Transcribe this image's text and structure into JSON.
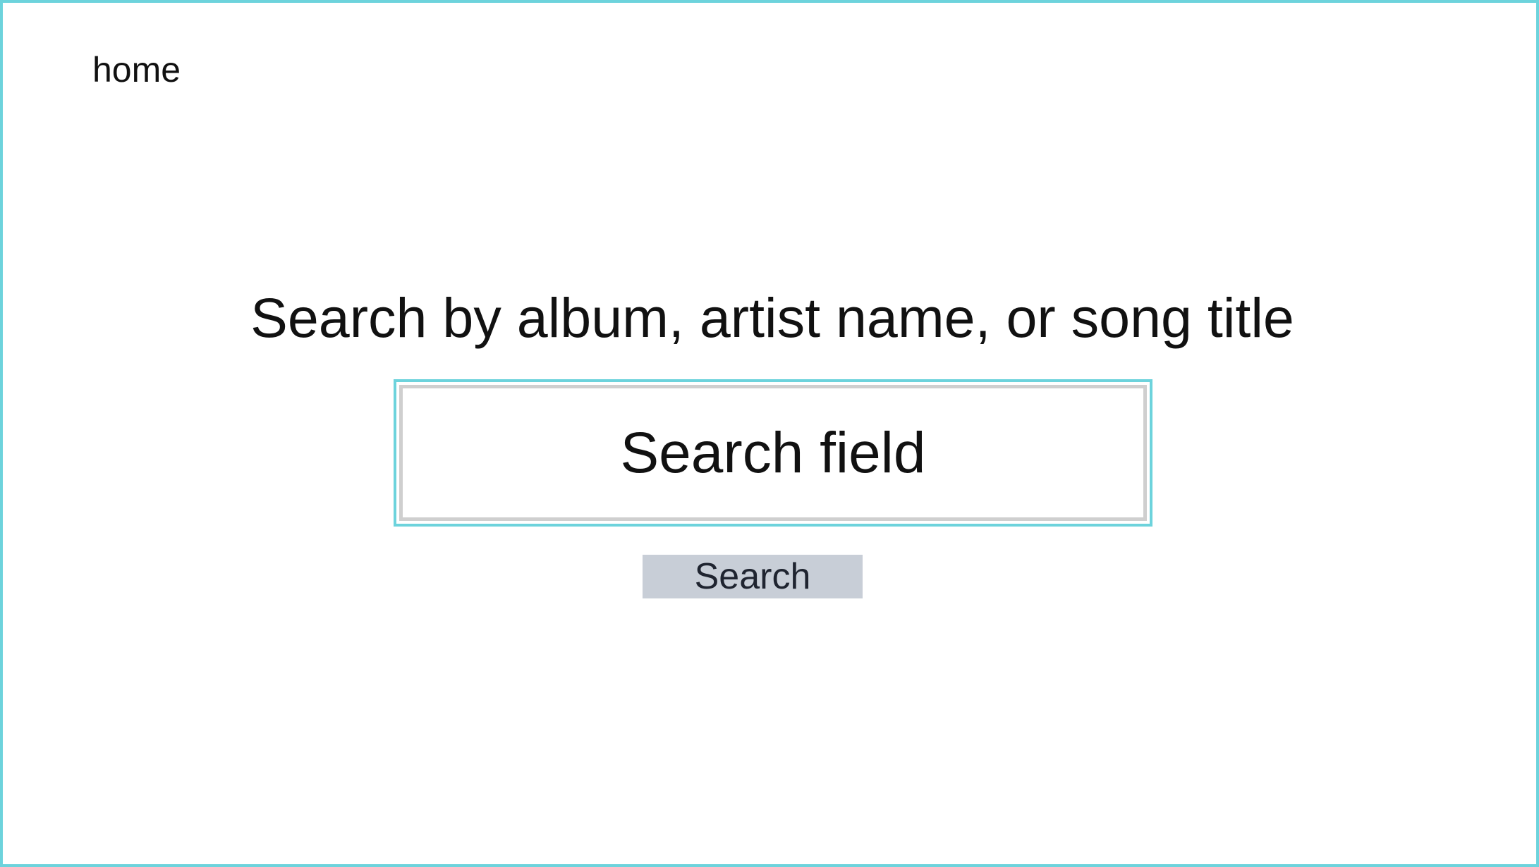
{
  "nav": {
    "home_label": "home"
  },
  "main": {
    "prompt": "Search by album, artist name, or song title",
    "search_field_label": "Search field",
    "search_button_label": "Search"
  },
  "colors": {
    "accent_border": "#6dd3dc",
    "inner_border": "#cfcfcf",
    "button_bg": "#c8ced7",
    "text": "#111111"
  }
}
